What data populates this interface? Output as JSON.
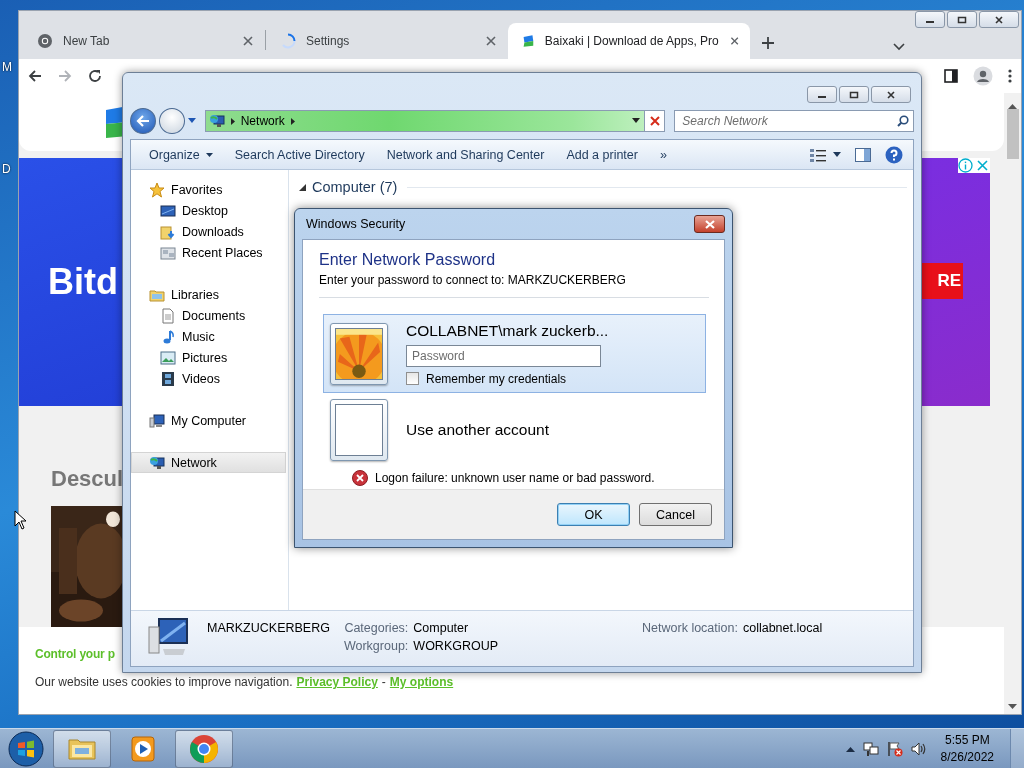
{
  "desktop": {
    "icon_labels": [
      "M",
      "D"
    ]
  },
  "browser": {
    "tabs": [
      {
        "title": "New Tab",
        "kind": "chrome",
        "selected": false
      },
      {
        "title": "Settings",
        "kind": "loading",
        "selected": false
      },
      {
        "title": "Baixaki | Download de Apps, Pro",
        "kind": "site",
        "selected": true
      }
    ],
    "page": {
      "banner_text": "Bitd",
      "banner_button": "RE",
      "heading": "Descul",
      "cookie_title": "Control your p",
      "cookie_text": "Our website uses cookies to improve navigation.",
      "cookie_links": [
        "Privacy Policy",
        "My options"
      ],
      "cookie_separator": "-"
    }
  },
  "explorer": {
    "address": {
      "loading": true,
      "crumbs": [
        "Network"
      ]
    },
    "search": {
      "placeholder": "Search Network"
    },
    "toolbar": [
      {
        "label": "Organize",
        "kind": "menu"
      },
      {
        "label": "Search Active Directory",
        "kind": "command"
      },
      {
        "label": "Network and Sharing Center",
        "kind": "command"
      },
      {
        "label": "Add a printer",
        "kind": "command"
      },
      {
        "label": "»",
        "kind": "more"
      }
    ],
    "nav": [
      {
        "label": "Favorites",
        "kind": "favorites",
        "selected": false,
        "children": [
          {
            "label": "Desktop",
            "kind": "desktop",
            "selected": false
          },
          {
            "label": "Downloads",
            "kind": "downloads",
            "selected": false
          },
          {
            "label": "Recent Places",
            "kind": "recent",
            "selected": false
          }
        ]
      },
      {
        "label": "Libraries",
        "kind": "libraries",
        "selected": false,
        "children": [
          {
            "label": "Documents",
            "kind": "documents",
            "selected": false
          },
          {
            "label": "Music",
            "kind": "music",
            "selected": false
          },
          {
            "label": "Pictures",
            "kind": "pictures",
            "selected": false
          },
          {
            "label": "Videos",
            "kind": "videos",
            "selected": false
          }
        ]
      },
      {
        "label": "My Computer",
        "kind": "computer",
        "selected": false
      },
      {
        "label": "Network",
        "kind": "network",
        "selected": true
      }
    ],
    "group": {
      "label": "Computer (7)",
      "expanded": true
    },
    "details": {
      "name": "MARKZUCKERBERG",
      "fields": [
        {
          "label": "Categories:",
          "value": "Computer"
        },
        {
          "label": "Workgroup:",
          "value": "WORKGROUP"
        },
        {
          "label": "Network location:",
          "value": "collabnet.local"
        }
      ]
    }
  },
  "dialog": {
    "title": "Windows Security",
    "heading": "Enter Network Password",
    "subtitle": "Enter your password to connect to: MARKZUCKERBERG",
    "accounts": [
      {
        "name": "COLLABNET\\mark zuckerb...",
        "kind": "user",
        "selected": true,
        "password": {
          "placeholder": "Password"
        },
        "remember": {
          "label": "Remember my credentials",
          "checked": false
        }
      },
      {
        "name": "Use another account",
        "kind": "other",
        "selected": false
      }
    ],
    "error": "Logon failure: unknown user name or bad password.",
    "buttons": [
      {
        "label": "OK",
        "default": true
      },
      {
        "label": "Cancel",
        "default": false
      }
    ]
  },
  "taskbar": {
    "apps": [
      {
        "kind": "explorer",
        "selected": true
      },
      {
        "kind": "media",
        "selected": false
      },
      {
        "kind": "chrome",
        "selected": true
      }
    ],
    "clock": {
      "time": "5:55 PM",
      "date": "8/26/2022"
    }
  }
}
